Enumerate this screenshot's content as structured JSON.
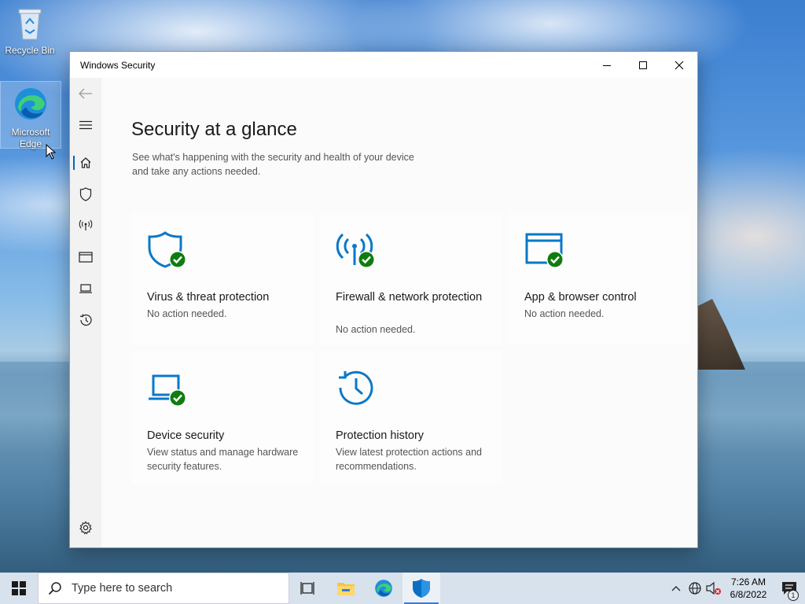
{
  "desktop": {
    "icons": [
      {
        "label": "Recycle Bin"
      },
      {
        "label": "Microsoft Edge"
      }
    ]
  },
  "window": {
    "title": "Windows Security",
    "controls": [
      "minimize",
      "maximize",
      "close"
    ]
  },
  "sidebar": {
    "items": [
      {
        "icon": "back-arrow-icon"
      },
      {
        "icon": "hamburger-icon"
      },
      {
        "icon": "home-icon",
        "active": true
      },
      {
        "icon": "shield-icon"
      },
      {
        "icon": "wireless-icon"
      },
      {
        "icon": "browser-window-icon"
      },
      {
        "icon": "laptop-icon"
      },
      {
        "icon": "history-icon"
      },
      {
        "icon": "gear-icon"
      }
    ]
  },
  "main": {
    "title": "Security at a glance",
    "subtitle": "See what's happening with the security and health of your device and take any actions needed.",
    "cards": [
      {
        "title": "Virus & threat protection",
        "desc": "No action needed.",
        "icon": "shield-check-icon"
      },
      {
        "title": "Firewall & network protection",
        "desc": "No action needed.",
        "icon": "firewall-check-icon"
      },
      {
        "title": "App & browser control",
        "desc": "No action needed.",
        "icon": "app-browser-check-icon"
      },
      {
        "title": "Device security",
        "desc": "View status and manage hardware security features.",
        "icon": "laptop-check-icon"
      },
      {
        "title": "Protection history",
        "desc": "View latest protection actions and recommendations.",
        "icon": "history-icon"
      }
    ]
  },
  "taskbar": {
    "search_placeholder": "Type here to search",
    "time": "7:26 AM",
    "date": "6/8/2022",
    "notification_count": "1"
  },
  "colors": {
    "accent": "#0067c0",
    "icon_blue": "#0a78c8",
    "check_green": "#107c10"
  }
}
